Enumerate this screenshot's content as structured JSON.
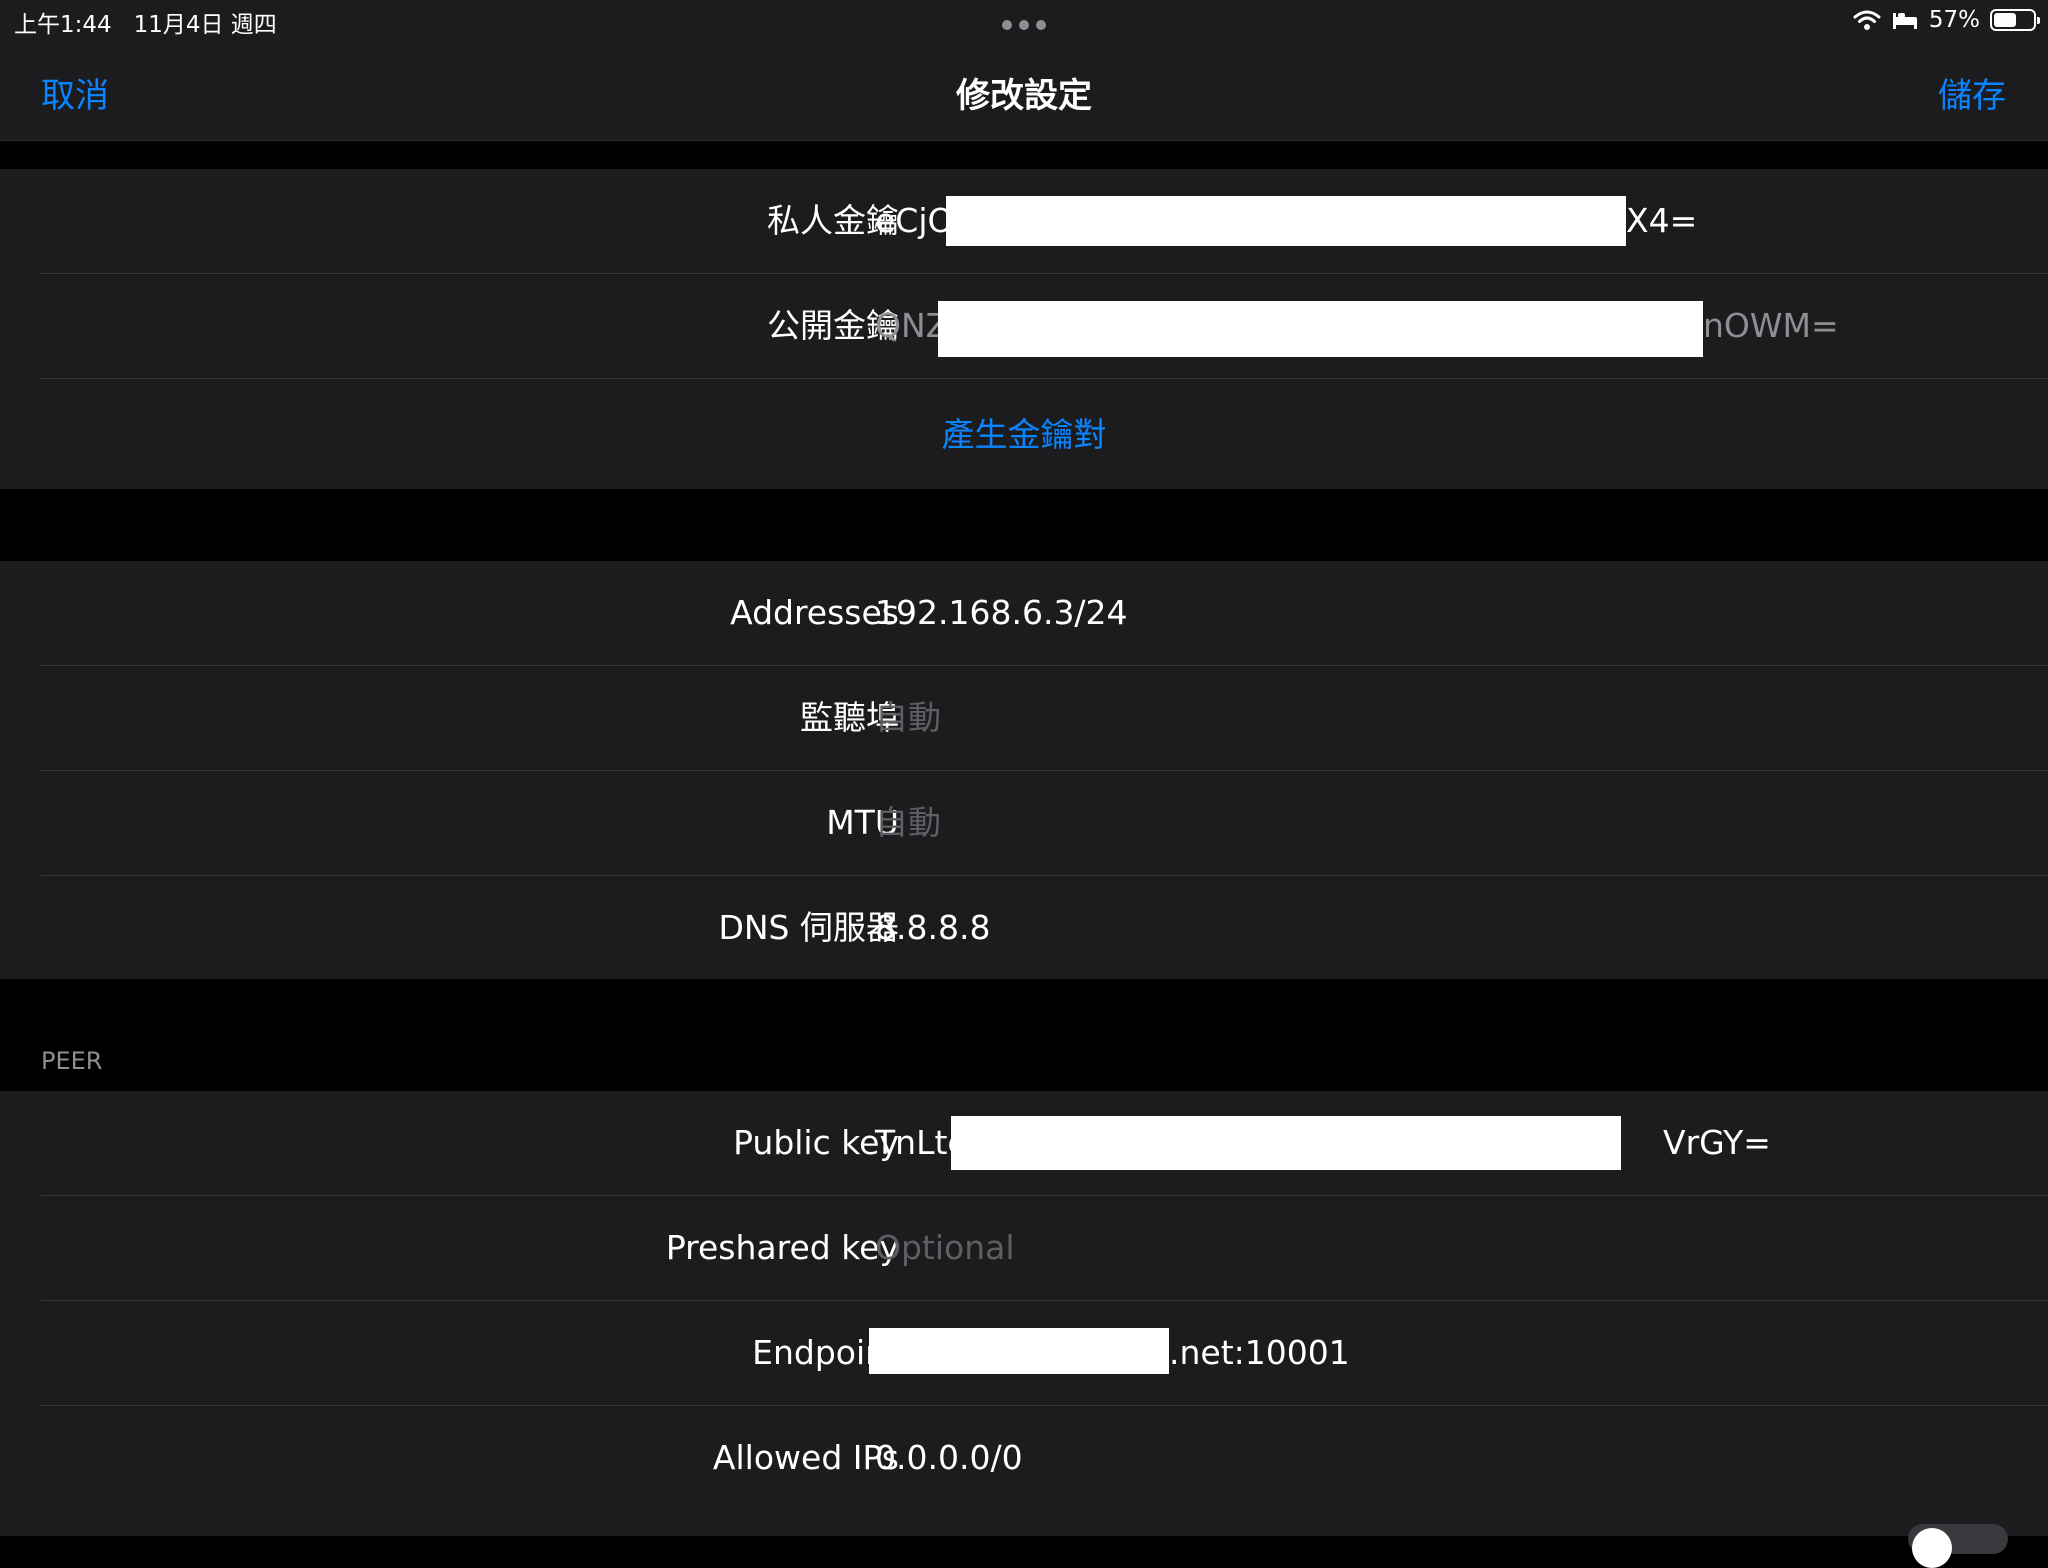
{
  "status_bar": {
    "time_date": "上午1:44   11月4日 週四",
    "battery_percent": "57%",
    "battery_level": 0.57
  },
  "nav": {
    "cancel": "取消",
    "title": "修改設定",
    "save": "儲存"
  },
  "interface": {
    "private_key_label": "私人金鑰",
    "private_key_prefix": "eCjO",
    "private_key_suffix": "X4=",
    "public_key_label": "公開金鑰",
    "public_key_prefix": "QNZ",
    "public_key_suffix": "nOWM=",
    "generate_keypair": "產生金鑰對"
  },
  "settings": {
    "addresses_label": "Addresses",
    "addresses_value": "192.168.6.3/24",
    "listen_port_label": "監聽埠",
    "listen_port_value": "自動",
    "mtu_label": "MTU",
    "mtu_value": "自動",
    "dns_label": "DNS 伺服器",
    "dns_value": "8.8.8.8"
  },
  "peer": {
    "header": "PEER",
    "public_key_label": "Public key",
    "public_key_prefix": "TnLte",
    "public_key_suffix": "VrGY=",
    "preshared_key_label": "Preshared key",
    "preshared_key_placeholder": "Optional",
    "endpoint_label": "Endpoint",
    "endpoint_suffix": ".net:10001",
    "allowed_ips_label": "Allowed IPs",
    "allowed_ips_value": "0.0.0.0/0"
  }
}
